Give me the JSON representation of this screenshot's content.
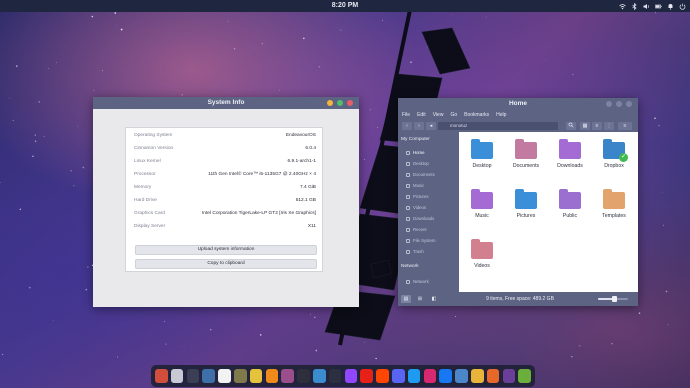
{
  "top_panel": {
    "clock": "8:20 PM",
    "tray_icons": [
      "network-icon",
      "bluetooth-icon",
      "volume-icon",
      "battery-icon",
      "notifications-icon",
      "power-icon"
    ]
  },
  "sysinfo_window": {
    "title": "System Info",
    "rows": [
      {
        "key": "Operating System",
        "value": "EndeavourOS"
      },
      {
        "key": "Cinnamon Version",
        "value": "6.0.4"
      },
      {
        "key": "Linux Kernel",
        "value": "6.9.1-arch1-1"
      },
      {
        "key": "Processor",
        "value": "11th Gen Intel© Core™ i5-1135G7 @ 2.40GHz × 4"
      },
      {
        "key": "Memory",
        "value": "7.4 GiB"
      },
      {
        "key": "Hard Drive",
        "value": "512.1 GB"
      },
      {
        "key": "Graphics Card",
        "value": "Intel Corporation TigerLake-LP GT2 [Iris Xe Graphics]"
      },
      {
        "key": "Display Server",
        "value": "X11"
      }
    ],
    "upload_label": "Upload system information",
    "copy_label": "Copy to clipboard"
  },
  "files_window": {
    "title": "Home",
    "menu": [
      "File",
      "Edit",
      "View",
      "Go",
      "Bookmarks",
      "Help"
    ],
    "path": "monotuz",
    "sidebar": {
      "my_computer": "My Computer",
      "items": [
        "Home",
        "Desktop",
        "Documents",
        "Music",
        "Pictures",
        "Videos",
        "Downloads",
        "Recent",
        "File System",
        "Trash"
      ],
      "network": "Network",
      "network_items": [
        "Network"
      ]
    },
    "folders": [
      {
        "label": "Desktop",
        "color": "#3b8fd8",
        "icon": "desktop-folder-icon"
      },
      {
        "label": "Documents",
        "color": "#c27aa0",
        "icon": "documents-folder-icon"
      },
      {
        "label": "Downloads",
        "color": "#a36bd3",
        "icon": "downloads-folder-icon"
      },
      {
        "label": "Dropbox",
        "color": "#3a84c9",
        "icon": "dropbox-folder-icon"
      },
      {
        "label": "Music",
        "color": "#a36bd3",
        "icon": "music-folder-icon"
      },
      {
        "label": "Pictures",
        "color": "#3b8fd8",
        "icon": "pictures-folder-icon"
      },
      {
        "label": "Public",
        "color": "#9b6fd0",
        "icon": "public-folder-icon"
      },
      {
        "label": "Templates",
        "color": "#e2a36c",
        "icon": "templates-folder-icon"
      },
      {
        "label": "Videos",
        "color": "#d27f8f",
        "icon": "videos-folder-icon"
      }
    ],
    "status": "9 items, Free space: 489.2 GB",
    "zoom_level": 0.55
  },
  "dock_icons": [
    {
      "name": "files-icon",
      "color": "#d24e3c",
      "glyph": ""
    },
    {
      "name": "trash-icon",
      "color": "#c9c9d6",
      "glyph": ""
    },
    {
      "name": "taskview-icon",
      "color": "#3a3f55",
      "glyph": ""
    },
    {
      "name": "system-monitor-icon",
      "color": "#3f6fa8",
      "glyph": ""
    },
    {
      "name": "text-editor-icon",
      "color": "#f2f2f2",
      "glyph": ""
    },
    {
      "name": "gimp-icon",
      "color": "#7f7a4a",
      "glyph": ""
    },
    {
      "name": "archive-icon",
      "color": "#e5c23c",
      "glyph": ""
    },
    {
      "name": "vlc-icon",
      "color": "#f08a1c",
      "glyph": ""
    },
    {
      "name": "image-viewer-icon",
      "color": "#9a4f8c",
      "glyph": ""
    },
    {
      "name": "record-icon",
      "color": "#2d2f3d",
      "glyph": ""
    },
    {
      "name": "settings-icon",
      "color": "#3a8ccf",
      "glyph": ""
    },
    {
      "name": "terminal-icon",
      "color": "#2b2f3f",
      "glyph": ""
    },
    {
      "name": "twitch-icon",
      "color": "#9146ff",
      "glyph": ""
    },
    {
      "name": "youtube-icon",
      "color": "#e62117",
      "glyph": ""
    },
    {
      "name": "reddit-icon",
      "color": "#ff4500",
      "glyph": ""
    },
    {
      "name": "discord-icon",
      "color": "#5865f2",
      "glyph": ""
    },
    {
      "name": "x-icon",
      "color": "#1d9bf0",
      "glyph": ""
    },
    {
      "name": "instagram-icon",
      "color": "#d6296f",
      "glyph": ""
    },
    {
      "name": "facebook-icon",
      "color": "#1877f2",
      "glyph": ""
    },
    {
      "name": "web-icon",
      "color": "#4a86c8",
      "glyph": ""
    },
    {
      "name": "chrome-icon",
      "color": "#e8b53a",
      "glyph": ""
    },
    {
      "name": "firefox-icon",
      "color": "#e8682a",
      "glyph": ""
    },
    {
      "name": "tor-icon",
      "color": "#6a3f98",
      "glyph": ""
    },
    {
      "name": "update-manager-icon",
      "color": "#6cae3b",
      "glyph": ""
    }
  ]
}
